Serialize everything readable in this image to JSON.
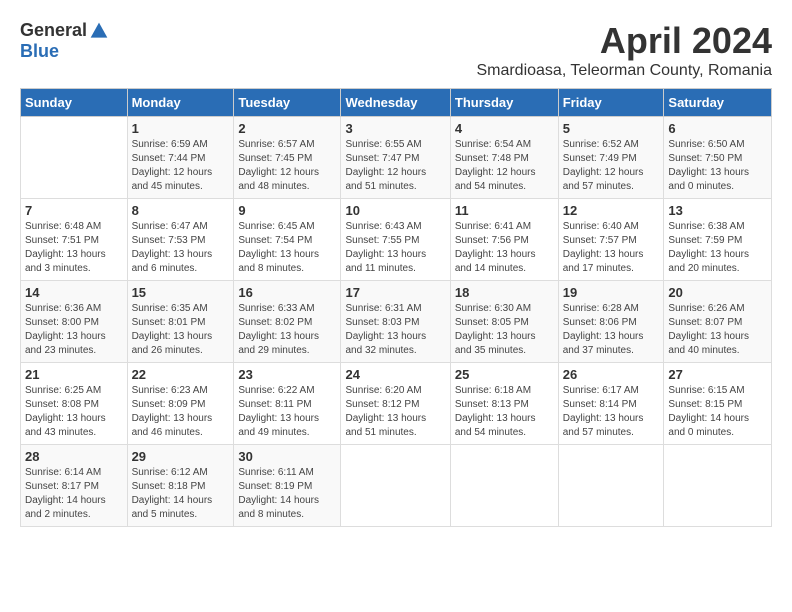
{
  "logo": {
    "general": "General",
    "blue": "Blue"
  },
  "title": "April 2024",
  "subtitle": "Smardioasa, Teleorman County, Romania",
  "days": [
    "Sunday",
    "Monday",
    "Tuesday",
    "Wednesday",
    "Thursday",
    "Friday",
    "Saturday"
  ],
  "weeks": [
    [
      {
        "day": "",
        "text": ""
      },
      {
        "day": "1",
        "text": "Sunrise: 6:59 AM\nSunset: 7:44 PM\nDaylight: 12 hours\nand 45 minutes."
      },
      {
        "day": "2",
        "text": "Sunrise: 6:57 AM\nSunset: 7:45 PM\nDaylight: 12 hours\nand 48 minutes."
      },
      {
        "day": "3",
        "text": "Sunrise: 6:55 AM\nSunset: 7:47 PM\nDaylight: 12 hours\nand 51 minutes."
      },
      {
        "day": "4",
        "text": "Sunrise: 6:54 AM\nSunset: 7:48 PM\nDaylight: 12 hours\nand 54 minutes."
      },
      {
        "day": "5",
        "text": "Sunrise: 6:52 AM\nSunset: 7:49 PM\nDaylight: 12 hours\nand 57 minutes."
      },
      {
        "day": "6",
        "text": "Sunrise: 6:50 AM\nSunset: 7:50 PM\nDaylight: 13 hours\nand 0 minutes."
      }
    ],
    [
      {
        "day": "7",
        "text": "Sunrise: 6:48 AM\nSunset: 7:51 PM\nDaylight: 13 hours\nand 3 minutes."
      },
      {
        "day": "8",
        "text": "Sunrise: 6:47 AM\nSunset: 7:53 PM\nDaylight: 13 hours\nand 6 minutes."
      },
      {
        "day": "9",
        "text": "Sunrise: 6:45 AM\nSunset: 7:54 PM\nDaylight: 13 hours\nand 8 minutes."
      },
      {
        "day": "10",
        "text": "Sunrise: 6:43 AM\nSunset: 7:55 PM\nDaylight: 13 hours\nand 11 minutes."
      },
      {
        "day": "11",
        "text": "Sunrise: 6:41 AM\nSunset: 7:56 PM\nDaylight: 13 hours\nand 14 minutes."
      },
      {
        "day": "12",
        "text": "Sunrise: 6:40 AM\nSunset: 7:57 PM\nDaylight: 13 hours\nand 17 minutes."
      },
      {
        "day": "13",
        "text": "Sunrise: 6:38 AM\nSunset: 7:59 PM\nDaylight: 13 hours\nand 20 minutes."
      }
    ],
    [
      {
        "day": "14",
        "text": "Sunrise: 6:36 AM\nSunset: 8:00 PM\nDaylight: 13 hours\nand 23 minutes."
      },
      {
        "day": "15",
        "text": "Sunrise: 6:35 AM\nSunset: 8:01 PM\nDaylight: 13 hours\nand 26 minutes."
      },
      {
        "day": "16",
        "text": "Sunrise: 6:33 AM\nSunset: 8:02 PM\nDaylight: 13 hours\nand 29 minutes."
      },
      {
        "day": "17",
        "text": "Sunrise: 6:31 AM\nSunset: 8:03 PM\nDaylight: 13 hours\nand 32 minutes."
      },
      {
        "day": "18",
        "text": "Sunrise: 6:30 AM\nSunset: 8:05 PM\nDaylight: 13 hours\nand 35 minutes."
      },
      {
        "day": "19",
        "text": "Sunrise: 6:28 AM\nSunset: 8:06 PM\nDaylight: 13 hours\nand 37 minutes."
      },
      {
        "day": "20",
        "text": "Sunrise: 6:26 AM\nSunset: 8:07 PM\nDaylight: 13 hours\nand 40 minutes."
      }
    ],
    [
      {
        "day": "21",
        "text": "Sunrise: 6:25 AM\nSunset: 8:08 PM\nDaylight: 13 hours\nand 43 minutes."
      },
      {
        "day": "22",
        "text": "Sunrise: 6:23 AM\nSunset: 8:09 PM\nDaylight: 13 hours\nand 46 minutes."
      },
      {
        "day": "23",
        "text": "Sunrise: 6:22 AM\nSunset: 8:11 PM\nDaylight: 13 hours\nand 49 minutes."
      },
      {
        "day": "24",
        "text": "Sunrise: 6:20 AM\nSunset: 8:12 PM\nDaylight: 13 hours\nand 51 minutes."
      },
      {
        "day": "25",
        "text": "Sunrise: 6:18 AM\nSunset: 8:13 PM\nDaylight: 13 hours\nand 54 minutes."
      },
      {
        "day": "26",
        "text": "Sunrise: 6:17 AM\nSunset: 8:14 PM\nDaylight: 13 hours\nand 57 minutes."
      },
      {
        "day": "27",
        "text": "Sunrise: 6:15 AM\nSunset: 8:15 PM\nDaylight: 14 hours\nand 0 minutes."
      }
    ],
    [
      {
        "day": "28",
        "text": "Sunrise: 6:14 AM\nSunset: 8:17 PM\nDaylight: 14 hours\nand 2 minutes."
      },
      {
        "day": "29",
        "text": "Sunrise: 6:12 AM\nSunset: 8:18 PM\nDaylight: 14 hours\nand 5 minutes."
      },
      {
        "day": "30",
        "text": "Sunrise: 6:11 AM\nSunset: 8:19 PM\nDaylight: 14 hours\nand 8 minutes."
      },
      {
        "day": "",
        "text": ""
      },
      {
        "day": "",
        "text": ""
      },
      {
        "day": "",
        "text": ""
      },
      {
        "day": "",
        "text": ""
      }
    ]
  ]
}
